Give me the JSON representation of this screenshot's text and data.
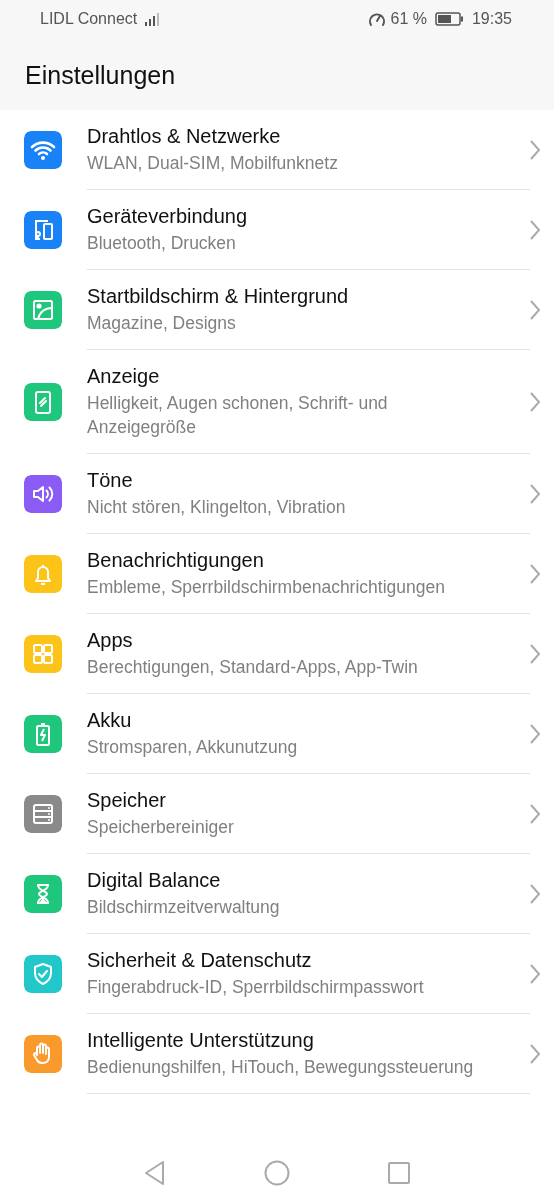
{
  "status_bar": {
    "carrier": "LIDL Connect",
    "battery_percent": "61 %",
    "time": "19:35"
  },
  "header": {
    "title": "Einstellungen"
  },
  "items": [
    {
      "title": "Drahtlos & Netzwerke",
      "subtitle": "WLAN, Dual-SIM, Mobilfunknetz",
      "kind": "wifi",
      "color": "#1a82f7"
    },
    {
      "title": "Geräteverbindung",
      "subtitle": "Bluetooth, Drucken",
      "kind": "devices",
      "color": "#1a82f7"
    },
    {
      "title": "Startbildschirm & Hintergrund",
      "subtitle": "Magazine, Designs",
      "kind": "image",
      "color": "#1ec77c"
    },
    {
      "title": "Anzeige",
      "subtitle": "Helligkeit, Augen schonen, Schrift- und Anzeigegröße",
      "kind": "display",
      "color": "#1ec77c"
    },
    {
      "title": "Töne",
      "subtitle": "Nicht stören, Klingelton, Vibration",
      "kind": "sound",
      "color": "#8a5cf5"
    },
    {
      "title": "Benachrichtigungen",
      "subtitle": "Embleme, Sperrbildschirmbenachrichtigungen",
      "kind": "bell",
      "color": "#fcc419"
    },
    {
      "title": "Apps",
      "subtitle": "Berechtigungen, Standard-Apps, App-Twin",
      "kind": "apps",
      "color": "#fcc419"
    },
    {
      "title": "Akku",
      "subtitle": "Stromsparen, Akkunutzung",
      "kind": "battery",
      "color": "#1ec77c"
    },
    {
      "title": "Speicher",
      "subtitle": "Speicherbereiniger",
      "kind": "storage",
      "color": "#8a8a8a"
    },
    {
      "title": "Digital Balance",
      "subtitle": "Bildschirmzeitverwaltung",
      "kind": "hourglass",
      "color": "#1ec77c"
    },
    {
      "title": "Sicherheit & Datenschutz",
      "subtitle": "Fingerabdruck-ID, Sperrbildschirmpasswort",
      "kind": "shield",
      "color": "#22c7c9"
    },
    {
      "title": "Intelligente Unterstützung",
      "subtitle": "Bedienungshilfen, HiTouch, Bewegungssteuerung",
      "kind": "hand",
      "color": "#fa9a2c"
    }
  ]
}
